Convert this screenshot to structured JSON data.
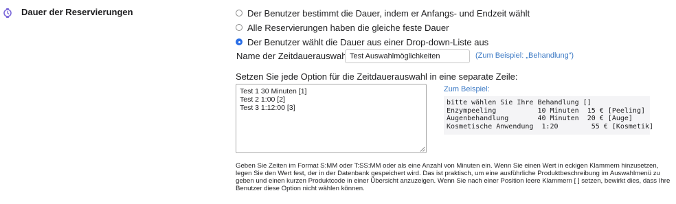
{
  "section": {
    "icon": "stopwatch-icon",
    "title": "Dauer der Reservierungen"
  },
  "duration_mode": {
    "options": [
      {
        "label": "Der Benutzer bestimmt die Dauer, indem er Anfangs- und Endzeit wählt",
        "selected": false
      },
      {
        "label": "Alle Reservierungen haben die gleiche feste Dauer",
        "selected": false
      },
      {
        "label": "Der Benutzer wählt die Dauer aus einer Drop-down-Liste aus",
        "selected": true
      }
    ]
  },
  "selection_name": {
    "label": "Name der Zeitdauerauswahl:",
    "value": "Test Auswahlmöglichkeiten",
    "hint": "(Zum Beispiel: „Behandlung“)"
  },
  "options_field": {
    "label": "Setzen Sie jede Option für die Zeitdauerauswahl in eine separate Zeile:",
    "value": "Test 1 30 Minuten [1]\nTest 2 1:00 [2]\nTest 3 1:12:00 [3]"
  },
  "example": {
    "link": "Zum Beispiel:",
    "lines": [
      "bitte wählen Sie Ihre Behandlung []",
      "Enzympeeling          10 Minuten  15 € [Peeling]",
      "Augenbehandlung       40 Minuten  20 € [Auge]",
      "Kosmetische Anwendung  1:20        55 € [Kosmetik]"
    ]
  },
  "help": {
    "text": "Geben Sie Zeiten im Format S:MM oder T:SS:MM oder als eine Anzahl von Minuten ein. Wenn Sie einen Wert in eckigen Klammern hinzusetzen, legen Sie den Wert fest, der in der Datenbank gespeichert wird. Das ist praktisch, um eine ausführliche Produktbeschreibung im Auswahlmenü zu geben und einen kurzen Produktcode in einer Übersicht anzuzeigen. Wenn Sie nach einer Position leere Klammern [ ] setzen, bewirkt dies, dass Ihre Benutzer diese Option nicht wählen können."
  },
  "colors": {
    "accent": "#2a6ee6",
    "link": "#3a78c4",
    "icon": "#7b68d9",
    "example_bg": "#f4f4f6"
  }
}
